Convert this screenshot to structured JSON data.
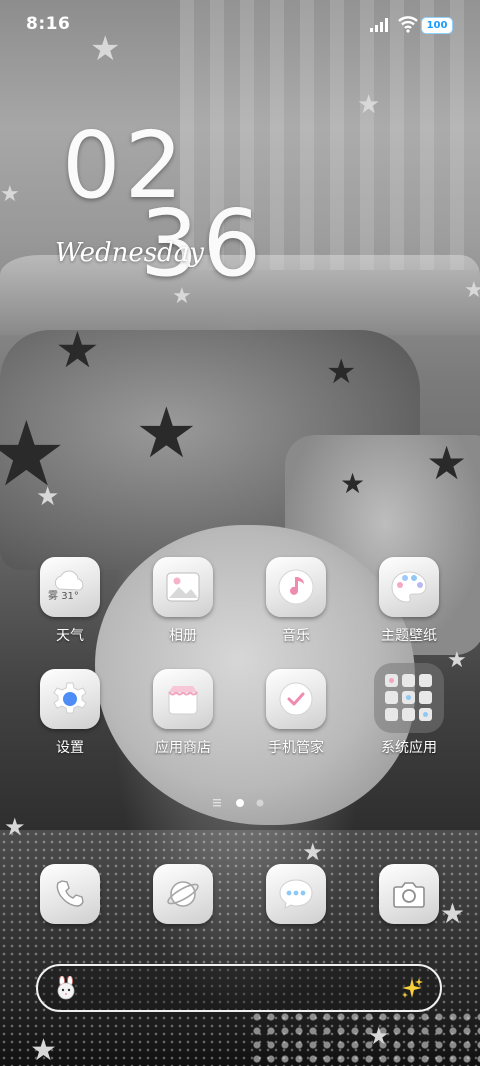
{
  "status_bar": {
    "time": "8:16",
    "battery": "100"
  },
  "clock_widget": {
    "hour": "02",
    "minute": "36",
    "weekday": "Wednesday"
  },
  "weather": {
    "condition": "雾",
    "temp": "31°"
  },
  "apps": [
    {
      "label": "天气",
      "icon": "weather-icon"
    },
    {
      "label": "相册",
      "icon": "photos-icon"
    },
    {
      "label": "音乐",
      "icon": "music-icon"
    },
    {
      "label": "主题壁纸",
      "icon": "palette-icon"
    },
    {
      "label": "设置",
      "icon": "gear-icon"
    },
    {
      "label": "应用商店",
      "icon": "store-icon"
    },
    {
      "label": "手机管家",
      "icon": "security-icon"
    },
    {
      "label": "系统应用",
      "icon": "folder-icon"
    }
  ],
  "dock": [
    {
      "icon": "phone-icon"
    },
    {
      "icon": "browser-icon"
    },
    {
      "icon": "messages-icon"
    },
    {
      "icon": "camera-icon"
    }
  ],
  "pager": {
    "pages": 2,
    "current": 1
  },
  "search": {
    "left_icon": "assistant-avatar-icon",
    "right_icon": "sparkle-icon"
  }
}
